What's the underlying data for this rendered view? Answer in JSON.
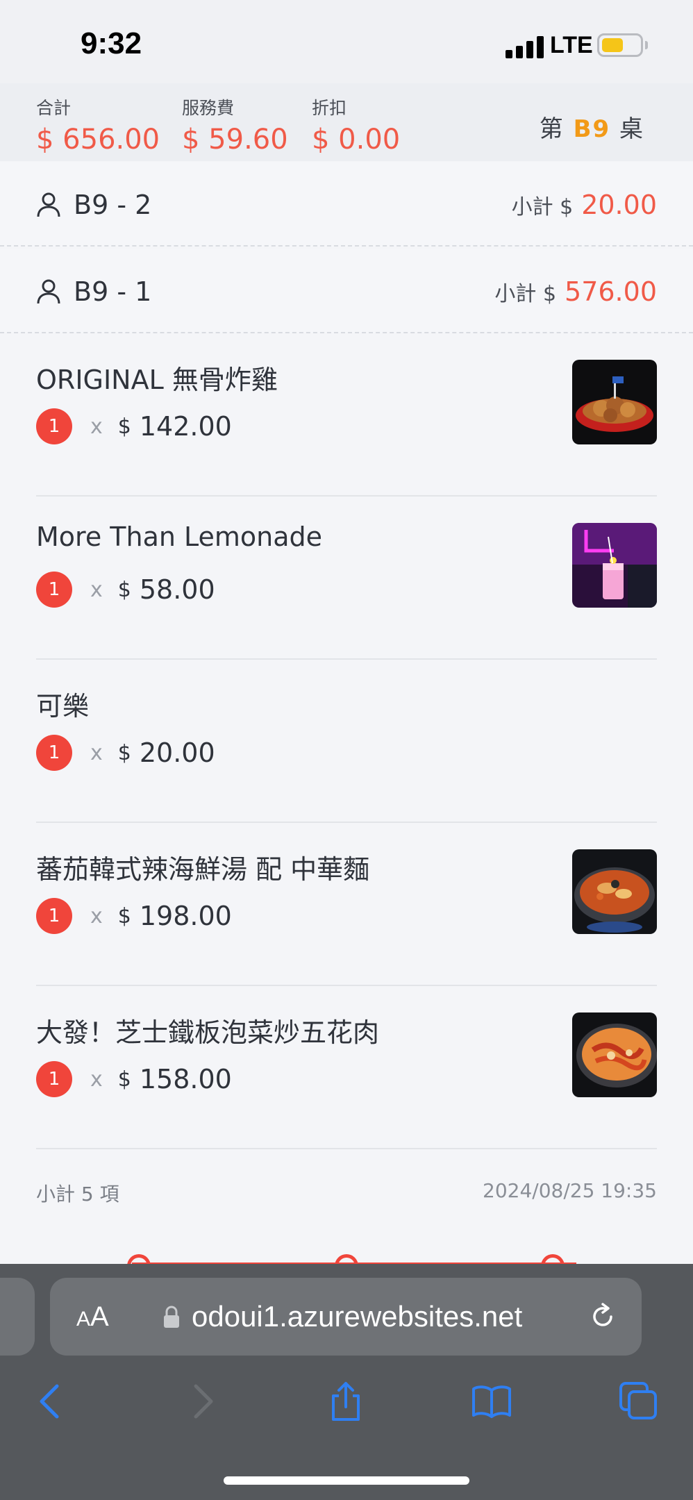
{
  "status_bar": {
    "time": "9:32",
    "network": "LTE",
    "battery_level": 0.55,
    "battery_color": "#f5c518"
  },
  "totals": {
    "total_label": "合計",
    "total_value": "$ 656.00",
    "service_label": "服務費",
    "service_value": "$ 59.60",
    "discount_label": "折扣",
    "discount_value": "$ 0.00",
    "table_prefix": "第",
    "table_code": "B9",
    "table_suffix": "桌"
  },
  "guests": [
    {
      "name": "B9 - 2",
      "subtotal_label": "小計 $",
      "subtotal_value": "20.00"
    },
    {
      "name": "B9 - 1",
      "subtotal_label": "小計 $",
      "subtotal_value": "576.00"
    }
  ],
  "items": [
    {
      "name": "ORIGINAL 無骨炸雞",
      "qty": "1",
      "x": "x",
      "currency": "$",
      "price": "142.00",
      "image": "fried-chicken-photo"
    },
    {
      "name": "More Than Lemonade",
      "qty": "1",
      "x": "x",
      "currency": "$",
      "price": "58.00",
      "image": "lemonade-photo"
    },
    {
      "name": "可樂",
      "qty": "1",
      "x": "x",
      "currency": "$",
      "price": "20.00",
      "image": ""
    },
    {
      "name": "蕃茄韓式辣海鮮湯 配 中華麵",
      "qty": "1",
      "x": "x",
      "currency": "$",
      "price": "198.00",
      "image": "seafood-soup-photo"
    },
    {
      "name": "大發！芝士鐵板泡菜炒五花肉",
      "qty": "1",
      "x": "x",
      "currency": "$",
      "price": "158.00",
      "image": "kimchi-pork-photo"
    }
  ],
  "footer": {
    "count": "小計 5 項",
    "timestamp": "2024/08/25 19:35"
  },
  "browser": {
    "aa_small": "A",
    "aa_big": "A",
    "url": "odoui1.azurewebsites.net"
  },
  "colors": {
    "accent_red": "#f05a48",
    "badge_red": "#f0453b",
    "table_code_orange": "#f29a18",
    "ios_blue": "#2f7ff2"
  }
}
